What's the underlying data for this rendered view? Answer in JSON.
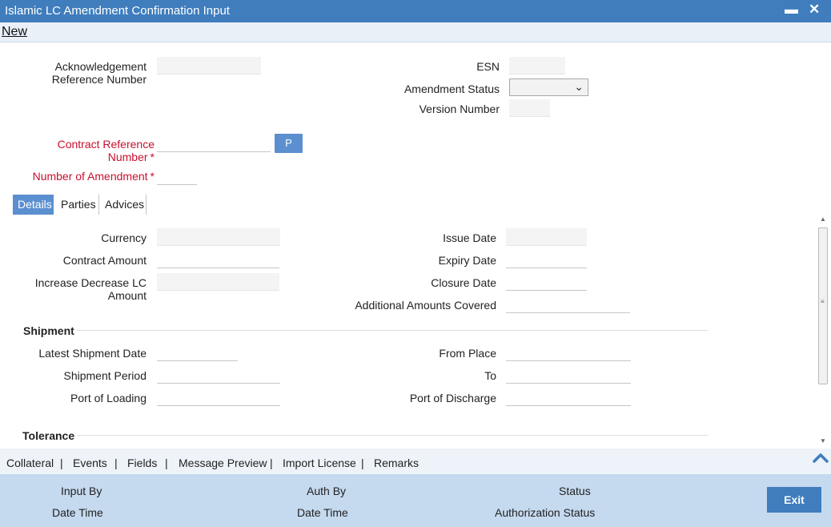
{
  "window": {
    "title": "Islamic LC Amendment Confirmation Input"
  },
  "toolbar": {
    "new_label": "New"
  },
  "header": {
    "ack_ref_label": "Acknowledgement Reference Number",
    "esn_label": "ESN",
    "amendment_status_label": "Amendment Status",
    "amendment_status_value": "",
    "version_number_label": "Version Number",
    "contract_ref_label": "Contract Reference Number",
    "p_button": "P",
    "num_amendment_label": "Number of Amendment",
    "required_mark": "*"
  },
  "tabs": [
    "Details",
    "Parties",
    "Advices"
  ],
  "details": {
    "currency_label": "Currency",
    "contract_amount_label": "Contract Amount",
    "increase_decrease_label": "Increase Decrease LC Amount",
    "issue_date_label": "Issue Date",
    "expiry_date_label": "Expiry Date",
    "closure_date_label": "Closure Date",
    "additional_amounts_label": "Additional Amounts Covered"
  },
  "shipment": {
    "section_title": "Shipment",
    "latest_shipment_date_label": "Latest Shipment Date",
    "shipment_period_label": "Shipment Period",
    "port_of_loading_label": "Port of Loading",
    "from_place_label": "From Place",
    "to_label": "To",
    "port_of_discharge_label": "Port of Discharge"
  },
  "tolerance": {
    "section_title": "Tolerance"
  },
  "linkbar": {
    "items": [
      "Collateral",
      "Events",
      "Fields",
      "Message Preview",
      "Import License",
      "Remarks"
    ],
    "separator": "|"
  },
  "footer": {
    "input_by": "Input By",
    "date_time_1": "Date Time",
    "auth_by": "Auth By",
    "date_time_2": "Date Time",
    "status": "Status",
    "authorization_status": "Authorization Status",
    "exit_label": "Exit"
  },
  "colors": {
    "titlebar": "#3f7dbd",
    "active_tab": "#5b8fcf",
    "required": "#c8102e",
    "footer": "#c5d9ef"
  }
}
